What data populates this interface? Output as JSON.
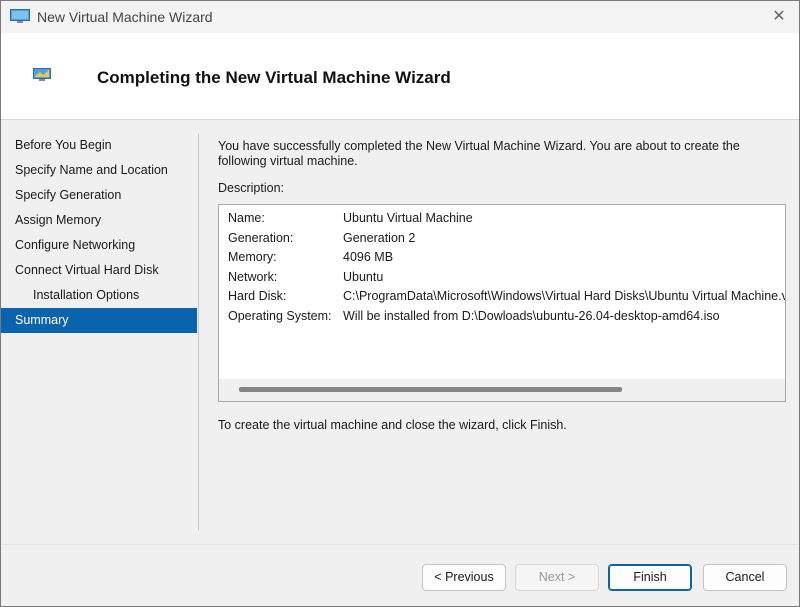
{
  "window": {
    "title": "New Virtual Machine Wizard",
    "close_glyph": "✕"
  },
  "header": {
    "title": "Completing the New Virtual Machine Wizard"
  },
  "nav": {
    "items": [
      {
        "label": "Before You Begin"
      },
      {
        "label": "Specify Name and Location"
      },
      {
        "label": "Specify Generation"
      },
      {
        "label": "Assign Memory"
      },
      {
        "label": "Configure Networking"
      },
      {
        "label": "Connect Virtual Hard Disk"
      },
      {
        "label": "Installation Options"
      },
      {
        "label": "Summary"
      }
    ],
    "selected": "Summary"
  },
  "content": {
    "intro": "You have successfully completed the New Virtual Machine Wizard. You are about to create the following virtual machine.",
    "description_label": "Description:",
    "summary": [
      {
        "key": "Name:",
        "value": "Ubuntu Virtual Machine"
      },
      {
        "key": "Generation:",
        "value": "Generation 2"
      },
      {
        "key": "Memory:",
        "value": "4096 MB"
      },
      {
        "key": "Network:",
        "value": "Ubuntu"
      },
      {
        "key": "Hard Disk:",
        "value": "C:\\ProgramData\\Microsoft\\Windows\\Virtual Hard Disks\\Ubuntu Virtual Machine.vhdx"
      },
      {
        "key": "Operating System:",
        "value": "Will be installed from D:\\Dowloads\\ubuntu-26.04-desktop-amd64.iso"
      }
    ],
    "finish_note": "To create the virtual machine and close the wizard, click Finish."
  },
  "buttons": {
    "previous": "< Previous",
    "next": "Next >",
    "finish": "Finish",
    "cancel": "Cancel"
  },
  "colors": {
    "selection": "#0a64ad",
    "header_bg": "#ffffff",
    "window_bg": "#f0f0f0"
  },
  "icons": {
    "title_icon": "vm-monitor-icon",
    "header_icon": "vm-monitor-icon",
    "close_icon": "close-icon"
  }
}
